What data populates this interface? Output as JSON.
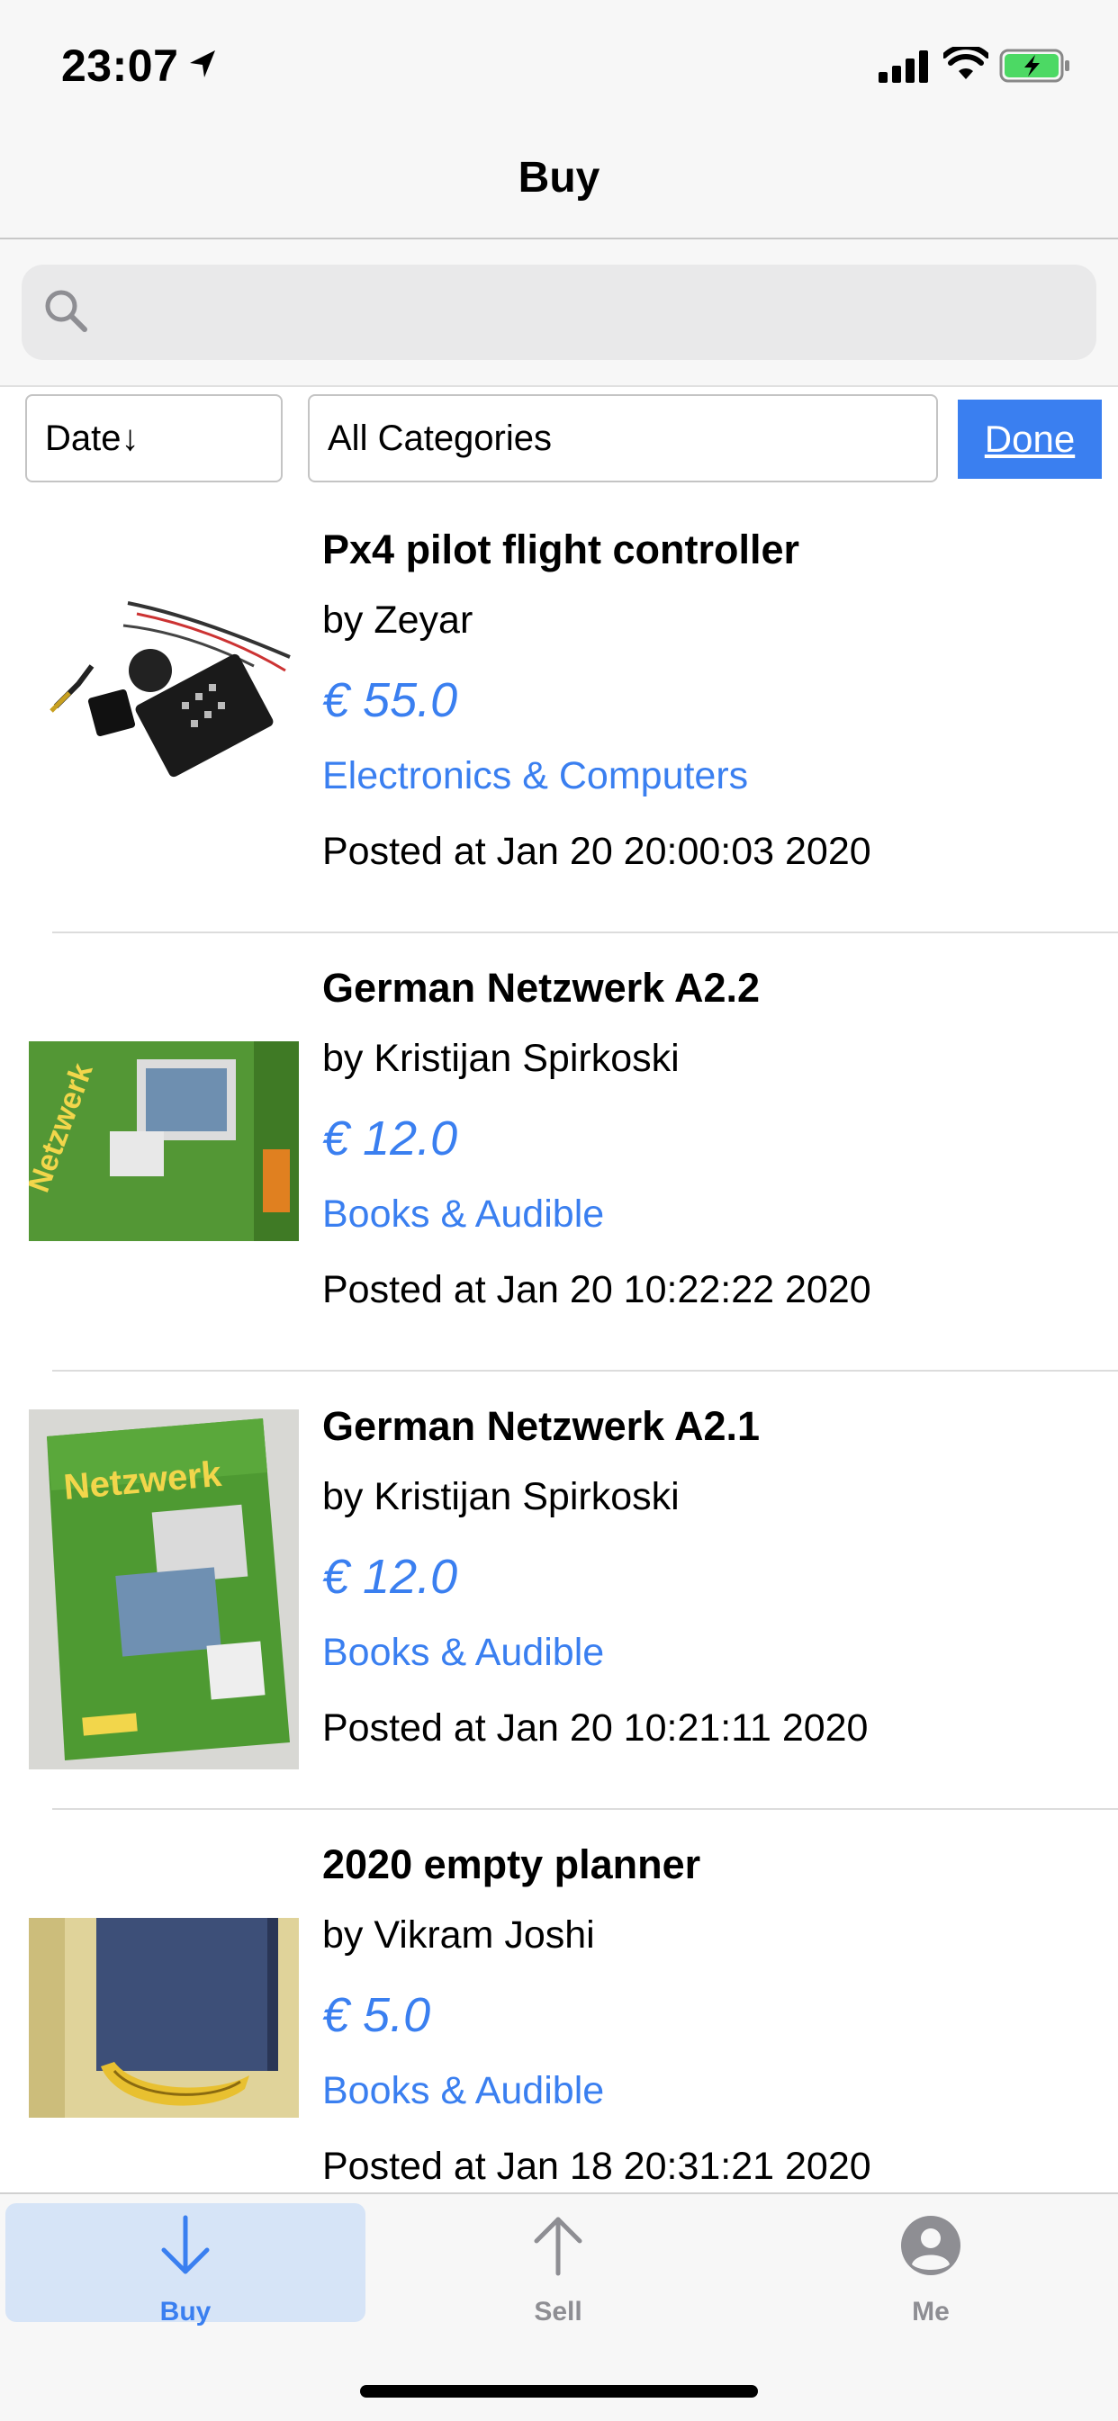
{
  "status_bar": {
    "time": "23:07"
  },
  "navbar": {
    "title": "Buy"
  },
  "search": {
    "placeholder": "",
    "value": ""
  },
  "filters": {
    "sort_label": "Date↓",
    "category_label": "All Categories",
    "done_label": "Done"
  },
  "items": [
    {
      "title": "Px4 pilot flight controller",
      "seller": "by Zeyar",
      "price": "€ 55.0",
      "category": "Electronics & Computers",
      "posted": "Posted at Jan 20 20:00:03 2020",
      "image": "flight-controller-photo"
    },
    {
      "title": "German Netzwerk A2.2",
      "seller": "by Kristijan Spirkoski",
      "price": "€ 12.0",
      "category": "Books & Audible",
      "posted": "Posted at Jan 20 10:22:22 2020",
      "image": "book-photo",
      "image_text": "Netzwerk"
    },
    {
      "title": "German Netzwerk A2.1",
      "seller": "by Kristijan Spirkoski",
      "price": "€ 12.0",
      "category": "Books & Audible",
      "posted": "Posted at Jan 20 10:21:11 2020",
      "image": "book-photo",
      "image_text": "Netzwerk"
    },
    {
      "title": "2020 empty planner",
      "seller": "by Vikram Joshi",
      "price": "€ 5.0",
      "category": "Books & Audible",
      "posted": "Posted at Jan 18 20:31:21 2020",
      "image": "planner-photo"
    }
  ],
  "tabbar": {
    "tabs": [
      {
        "label": "Buy",
        "icon": "arrow-down-icon",
        "active": true
      },
      {
        "label": "Sell",
        "icon": "arrow-up-icon",
        "active": false
      },
      {
        "label": "Me",
        "icon": "person-icon",
        "active": false
      }
    ]
  },
  "colors": {
    "accent": "#3a7ff0",
    "active_tab_bg": "#d6e4f7",
    "bar_bg": "#f7f7f7",
    "inactive_icon": "#8e8e93"
  }
}
